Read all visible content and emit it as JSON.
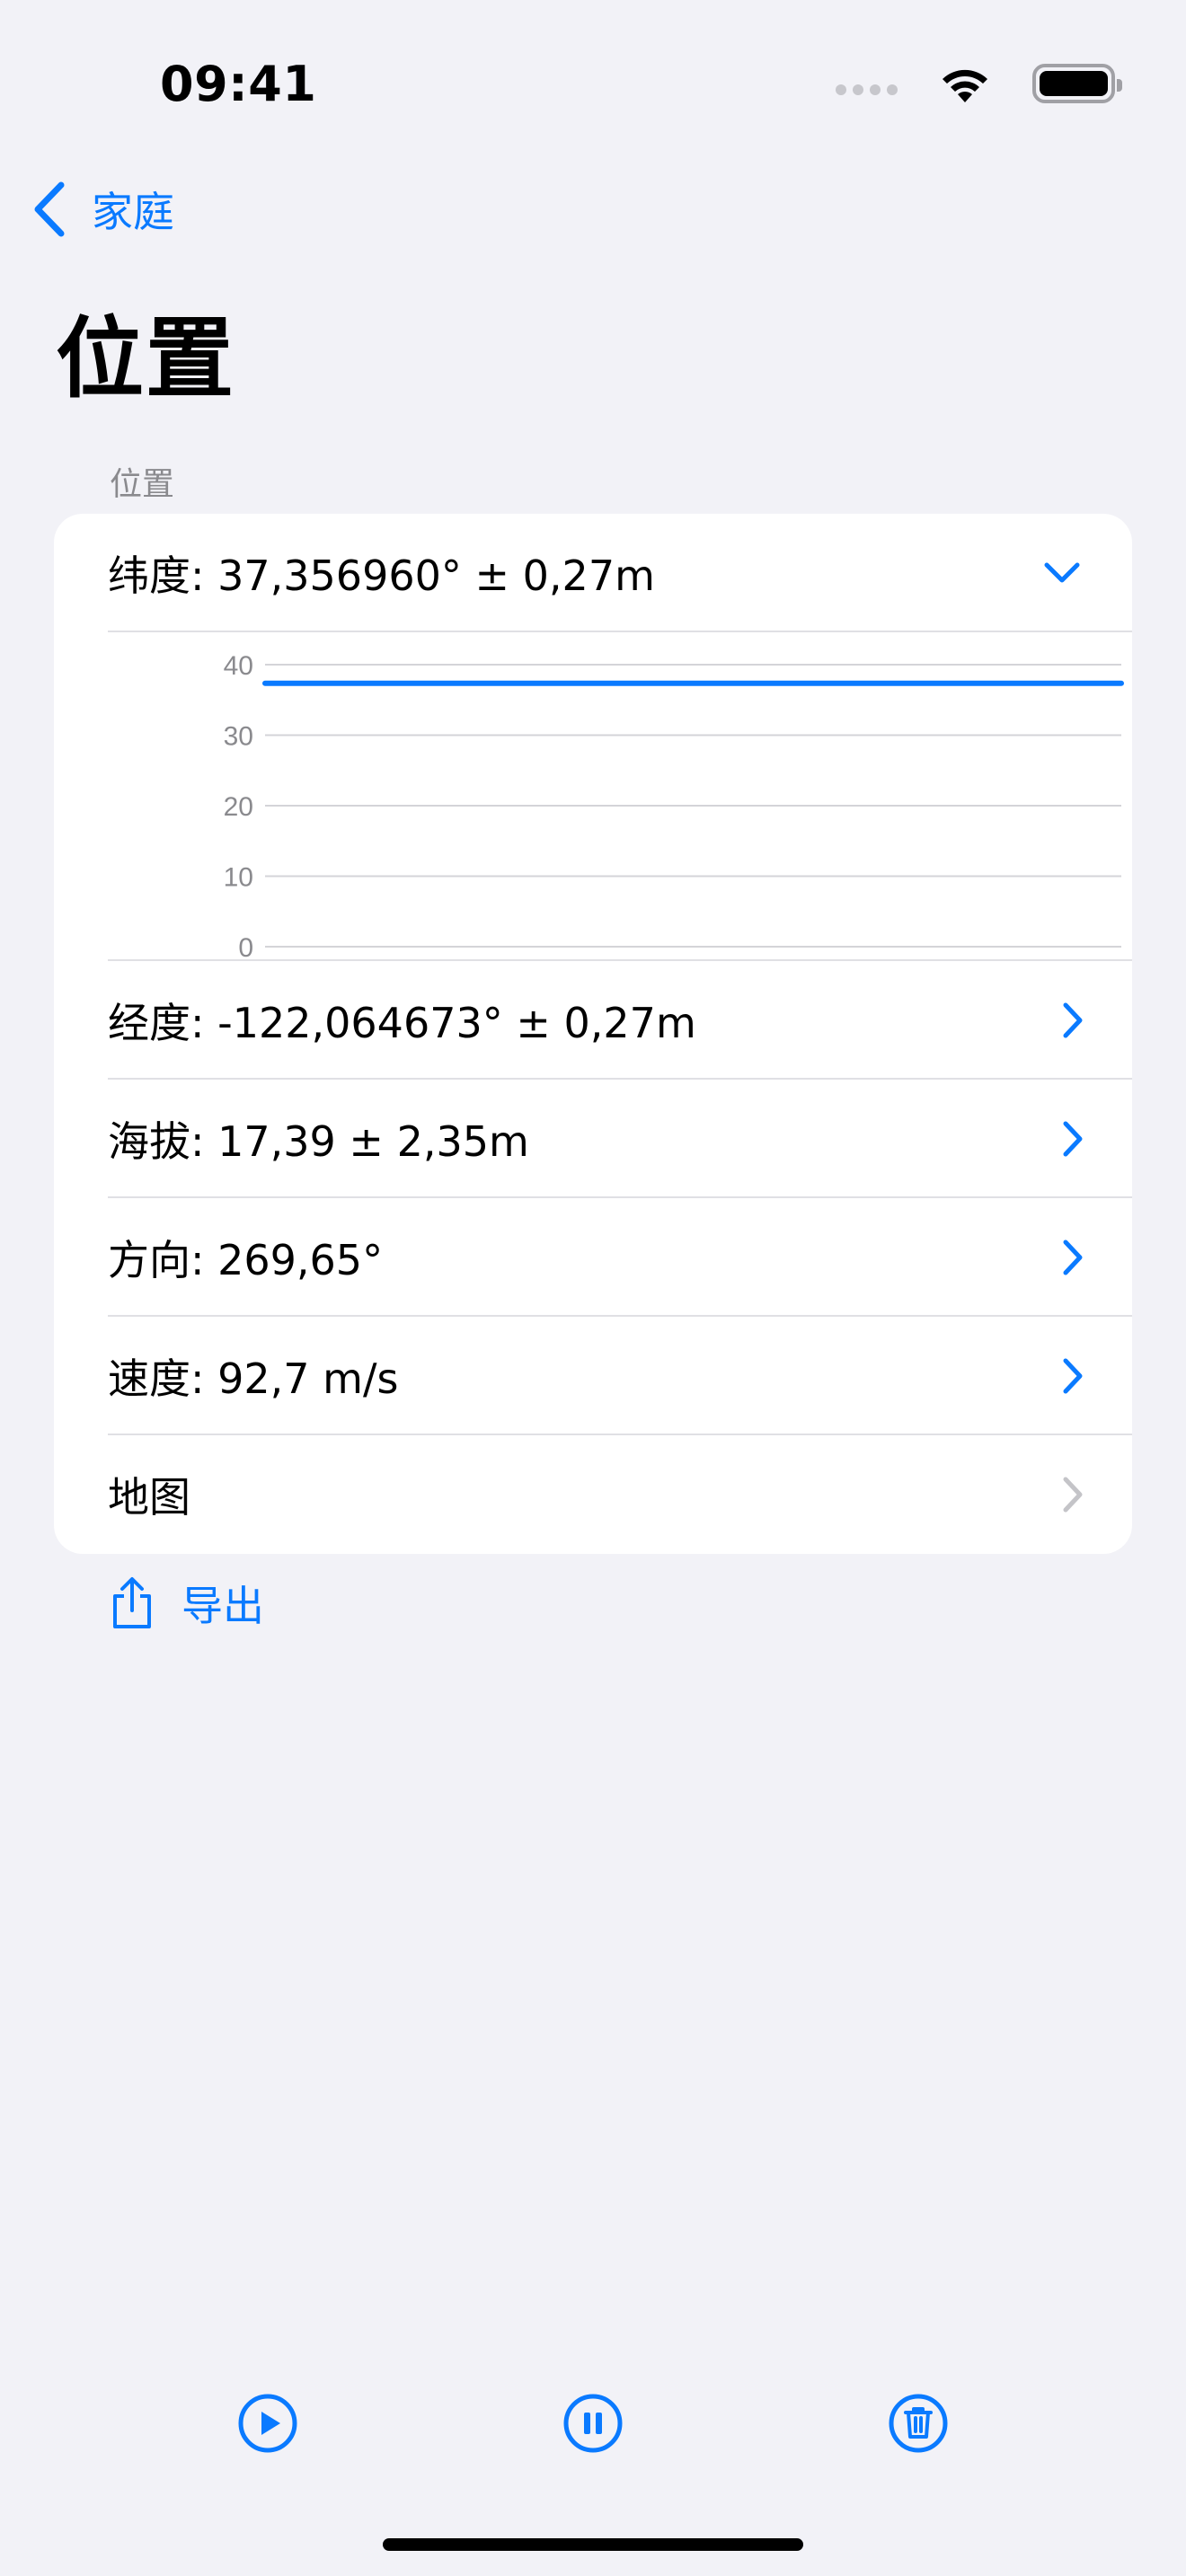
{
  "status_bar": {
    "time": "09:41"
  },
  "nav": {
    "back_label": "家庭",
    "title": "位置"
  },
  "section": {
    "header": "位置"
  },
  "rows": [
    {
      "label": "纬度: 37,356960° ± 0,27m",
      "expanded": true
    },
    {
      "label": "经度: -122,064673° ± 0,27m",
      "expanded": false
    },
    {
      "label": "海拔: 17,39 ± 2,35m",
      "expanded": false
    },
    {
      "label": "方向: 269,65°",
      "expanded": false
    },
    {
      "label": "速度: 92,7 m/s",
      "expanded": false
    },
    {
      "label": "地图",
      "expanded": false,
      "disabled": true
    }
  ],
  "chart_data": {
    "type": "line",
    "ylim": [
      0,
      40
    ],
    "yticks": [
      "40",
      "30",
      "20",
      "10",
      "0"
    ],
    "series": [
      {
        "values": [
          37.36,
          37.35,
          37.36,
          37.36,
          37.35,
          37.36,
          37.36,
          37.35,
          37.36,
          37.36
        ]
      }
    ],
    "grid": true
  },
  "export": {
    "label": "导出"
  },
  "toolbar": {
    "play": "play-icon",
    "pause": "pause-icon",
    "trash": "trash-icon"
  },
  "colors": {
    "accent": "#0a7aff",
    "background": "#f2f2f7",
    "card": "#ffffff",
    "secondary_text": "#8a8a8e",
    "disabled_chevron": "#c4c4c8"
  }
}
